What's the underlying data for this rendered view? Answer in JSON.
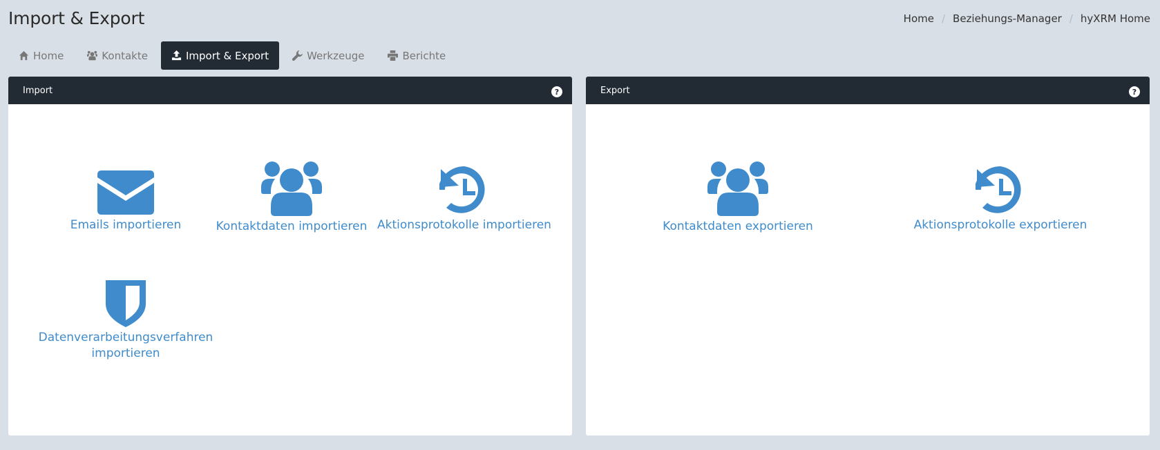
{
  "page": {
    "title": "Import & Export"
  },
  "breadcrumb": {
    "home": "Home",
    "manager": "Beziehungs-Manager",
    "app_home": "hyXRM Home"
  },
  "tabs": [
    {
      "label": "Home",
      "icon": "home-icon"
    },
    {
      "label": "Kontakte",
      "icon": "users-icon"
    },
    {
      "label": "Import & Export",
      "icon": "upload-icon",
      "active": true
    },
    {
      "label": "Werkzeuge",
      "icon": "wrench-icon"
    },
    {
      "label": "Berichte",
      "icon": "print-icon"
    }
  ],
  "import_panel": {
    "title": "Import",
    "help": "?",
    "actions": {
      "emails": {
        "label": "Emails importieren",
        "icon": "envelope-icon"
      },
      "contacts": {
        "label": "Kontaktdaten importieren",
        "icon": "users-icon"
      },
      "logs": {
        "label": "Aktionsprotokolle importieren",
        "icon": "history-icon"
      },
      "procedures_line1": "Datenverarbeitungsverfahren",
      "procedures_line2": "importieren",
      "procedures_icon": "shield-icon"
    }
  },
  "export_panel": {
    "title": "Export",
    "help": "?",
    "actions": {
      "contacts": {
        "label": "Kontaktdaten exportieren",
        "icon": "users-icon"
      },
      "logs": {
        "label": "Aktionsprotokolle exportieren",
        "icon": "history-icon"
      }
    }
  },
  "colors": {
    "accent": "#3f8bcb",
    "dark": "#222a33",
    "background": "#d9dfe7"
  }
}
